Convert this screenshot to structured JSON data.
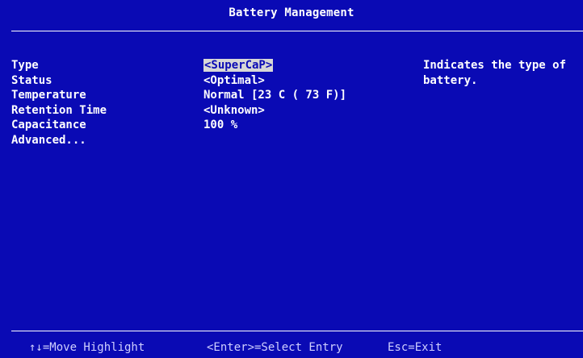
{
  "header": {
    "title": "Battery Management"
  },
  "settings": [
    {
      "label": "Type",
      "value": "<SuperCaP>",
      "selected": true
    },
    {
      "label": "Status",
      "value": "<Optimal>",
      "selected": false
    },
    {
      "label": "Temperature",
      "value": "Normal [23 C ( 73 F)]",
      "selected": false
    },
    {
      "label": "Retention Time",
      "value": "<Unknown>",
      "selected": false
    },
    {
      "label": "Capacitance",
      "value": "100 %",
      "selected": false
    },
    {
      "label": "Advanced...",
      "value": "",
      "selected": false
    }
  ],
  "help": {
    "text": "Indicates the type of battery."
  },
  "footer": {
    "move": "↑↓=Move Highlight",
    "select": "<Enter>=Select Entry",
    "exit": "Esc=Exit"
  },
  "colors": {
    "background": "#0a0ab4",
    "text": "#ffffff",
    "highlight": "#d7d7d7"
  }
}
